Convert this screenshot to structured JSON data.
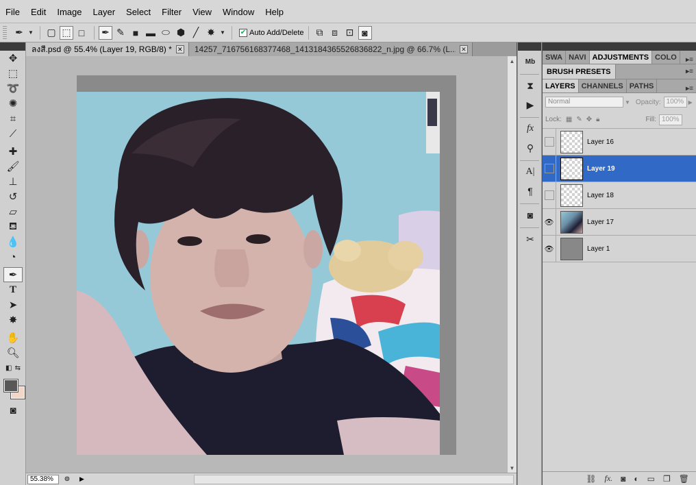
{
  "menu": [
    "File",
    "Edit",
    "Image",
    "Layer",
    "Select",
    "Filter",
    "View",
    "Window",
    "Help"
  ],
  "options": {
    "auto_add_delete_label": "Auto Add/Delete",
    "auto_add_delete_checked": true
  },
  "tabs": [
    {
      "title": "ลงสี.psd @ 55.4% (Layer 19, RGB/8) *",
      "active": true
    },
    {
      "title": "14257_716756168377468_1413184365526836822_n.jpg @ 66.7% (L...",
      "active": false
    }
  ],
  "status": {
    "zoom": "55.38%"
  },
  "panels": {
    "top_tabs": [
      "SWA",
      "NAVI",
      "ADJUSTMENTS",
      "COLO"
    ],
    "active_top_tab": "ADJUSTMENTS",
    "brush_presets": "BRUSH PRESETS",
    "layer_tabs": [
      "LAYERS",
      "CHANNELS",
      "PATHS"
    ],
    "blend_mode": "Normal",
    "opacity_label": "Opacity:",
    "opacity_value": "100%",
    "lock_label": "Lock:",
    "fill_label": "Fill:",
    "fill_value": "100%"
  },
  "layers": [
    {
      "name": "Layer 16",
      "visible": false,
      "thumb": "transparent",
      "selected": false
    },
    {
      "name": "Layer 19",
      "visible": false,
      "thumb": "transparent",
      "selected": true
    },
    {
      "name": "Layer 18",
      "visible": false,
      "thumb": "transparent",
      "selected": false
    },
    {
      "name": "Layer 17",
      "visible": true,
      "thumb": "photo",
      "selected": false
    },
    {
      "name": "Layer 1",
      "visible": true,
      "thumb": "gray",
      "selected": false
    }
  ],
  "colors": {
    "foreground": "#585858",
    "background": "#f2d7c8",
    "selection": "#3169c6"
  }
}
